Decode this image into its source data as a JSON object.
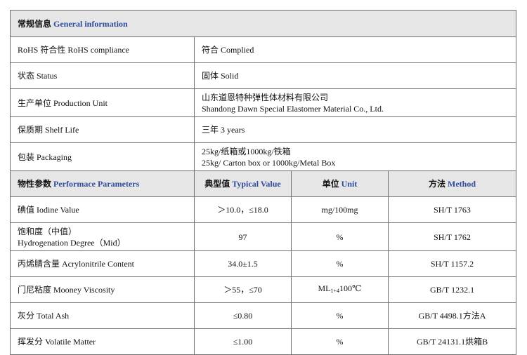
{
  "general": {
    "title_zh": "常规信息",
    "title_en": "General information",
    "rows": [
      {
        "label": "RoHS 符合性  RoHS compliance",
        "lines": [
          "符合  Complied"
        ]
      },
      {
        "label": "状态  Status",
        "lines": [
          "固体 Solid"
        ]
      },
      {
        "label": "生产单位  Production Unit",
        "lines": [
          "山东道恩特种弹性体材料有限公司",
          "Shandong Dawn Special Elastomer Material Co., Ltd."
        ]
      },
      {
        "label": "保质期  Shelf Life",
        "lines": [
          "三年 3 years"
        ]
      },
      {
        "label": "包装 Packaging",
        "lines": [
          "25kg/纸箱或1000kg/铁箱",
          "25kg/ Carton box or 1000kg/Metal Box"
        ]
      }
    ]
  },
  "performance": {
    "headers": [
      {
        "zh": "物性参数",
        "en": "Performace Parameters"
      },
      {
        "zh": "典型值",
        "en": "Typical Value"
      },
      {
        "zh": "单位",
        "en": "Unit"
      },
      {
        "zh": "方法",
        "en": "Method"
      }
    ],
    "rows": [
      {
        "name": [
          "碘值  Iodine Value"
        ],
        "value": "＞10.0，≤18.0",
        "unit": "mg/100mg",
        "method": "SH/T 1763"
      },
      {
        "name": [
          "饱和度（中值）",
          "Hydrogenation Degree（Mid）"
        ],
        "value": "97",
        "unit": "%",
        "method": "SH/T 1762"
      },
      {
        "name": [
          "丙烯腈含量 Acrylonitrile Content"
        ],
        "value": "34.0±1.5",
        "unit": "%",
        "method": "SH/T 1157.2"
      },
      {
        "name": [
          "门尼粘度  Mooney Viscosity"
        ],
        "value": "＞55，≤70",
        "unit_prefix": "ML",
        "unit_sub": "1+4",
        "unit_suffix": "100℃",
        "method": "GB/T 1232.1"
      },
      {
        "name": [
          "灰分  Total Ash"
        ],
        "value": "≤0.80",
        "unit": "%",
        "method": "GB/T 4498.1方法A"
      },
      {
        "name": [
          "挥发分  Volatile Matter"
        ],
        "value": "≤1.00",
        "unit": "%",
        "method": "GB/T 24131.1烘箱B"
      }
    ]
  }
}
